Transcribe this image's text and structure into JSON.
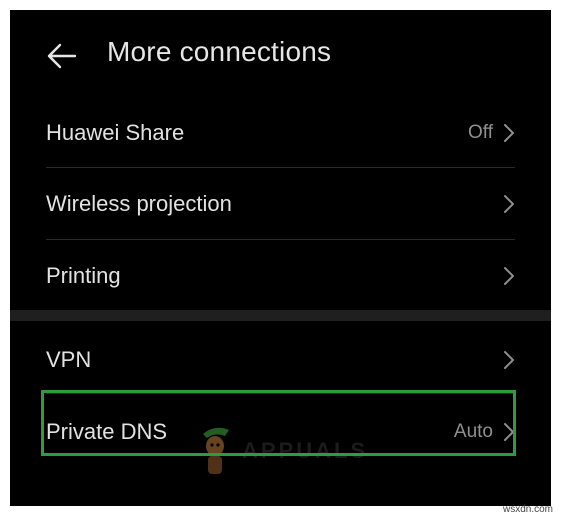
{
  "header": {
    "title": "More connections",
    "back_icon": "arrow-left-icon"
  },
  "items": [
    {
      "label": "Huawei Share",
      "value": "Off"
    },
    {
      "label": "Wireless projection",
      "value": ""
    },
    {
      "label": "Printing",
      "value": ""
    },
    {
      "label": "VPN",
      "value": ""
    },
    {
      "label": "Private DNS",
      "value": "Auto"
    }
  ],
  "highlight": {
    "target": "Private DNS",
    "color": "#2f9b3c"
  },
  "watermark": {
    "text": "APPUALS"
  },
  "credit": "wsxdn.com",
  "colors": {
    "background": "#000000",
    "text": "#e2e2e2",
    "secondary_text": "#8f8f8f",
    "highlight": "#2f9b3c"
  }
}
